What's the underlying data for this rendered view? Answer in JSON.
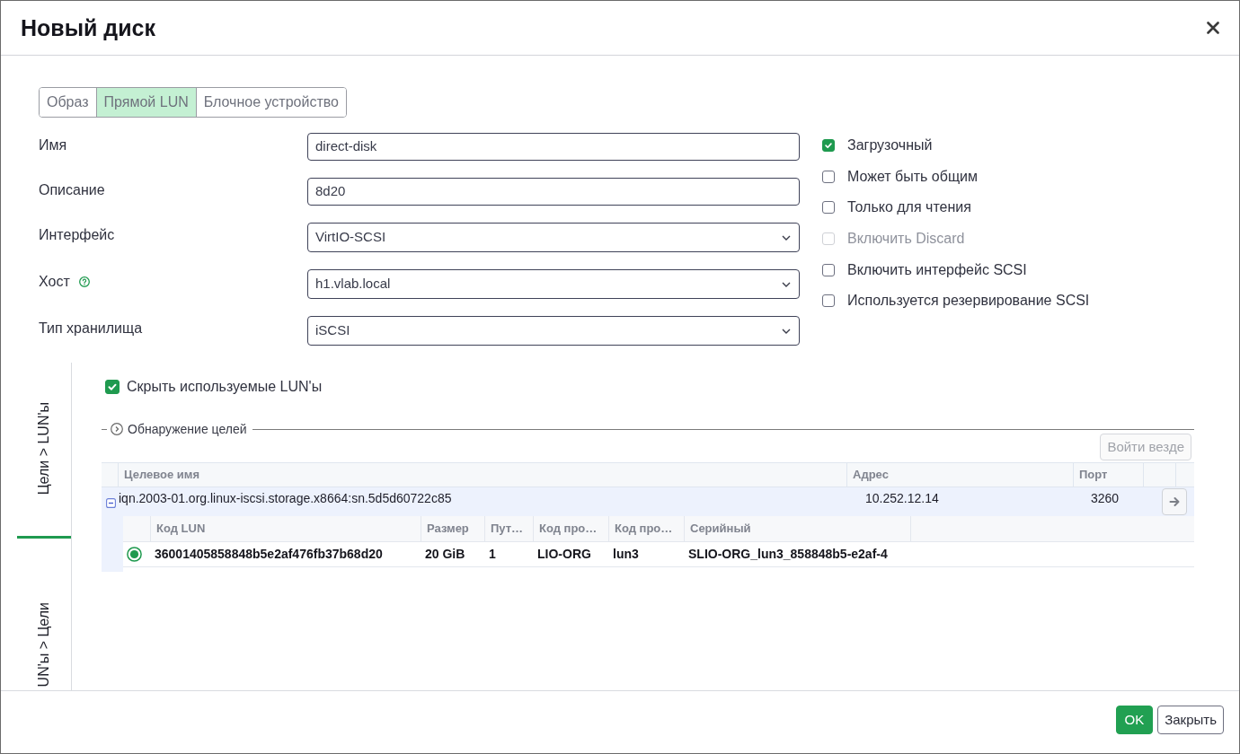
{
  "dialog": {
    "title": "Новый диск"
  },
  "disk_type_tabs": [
    {
      "label": "Образ",
      "selected": false
    },
    {
      "label": "Прямой LUN",
      "selected": true
    },
    {
      "label": "Блочное устройство",
      "selected": false
    }
  ],
  "fields": [
    {
      "label": "Имя",
      "kind": "text",
      "value": "direct-disk",
      "help": false
    },
    {
      "label": "Описание",
      "kind": "text",
      "value": "8d20",
      "help": false
    },
    {
      "label": "Интерфейс",
      "kind": "select",
      "value": "VirtIO-SCSI",
      "help": false
    },
    {
      "label": "Хост",
      "kind": "select",
      "value": "h1.vlab.local",
      "help": true
    },
    {
      "label": "Тип хранилища",
      "kind": "select",
      "value": "iSCSI",
      "help": false
    }
  ],
  "options": [
    {
      "label": "Загрузочный",
      "checked": true,
      "disabled": false
    },
    {
      "label": "Может быть общим",
      "checked": false,
      "disabled": false
    },
    {
      "label": "Только для чтения",
      "checked": false,
      "disabled": false
    },
    {
      "label": "Включить Discard",
      "checked": false,
      "disabled": true
    },
    {
      "label": "Включить интерфейс SCSI",
      "checked": false,
      "disabled": false
    },
    {
      "label": "Используется резервирование SCSI",
      "checked": false,
      "disabled": false
    }
  ],
  "storage_view_tabs": [
    {
      "label": "Цели > LUN'ы",
      "selected": true
    },
    {
      "label": "UN'ы > Цели",
      "selected": false
    }
  ],
  "hide_used_luns": {
    "label": "Скрыть используемые LUN'ы",
    "checked": true
  },
  "discovery": {
    "label": "Обнаружение целей",
    "expanded": false
  },
  "login_all_button": {
    "label": "Войти везде",
    "disabled": true
  },
  "targets": {
    "columns": [
      "Целевое имя",
      "Адрес",
      "Порт"
    ],
    "rows": [
      {
        "cells": [
          "iqn.2003-01.org.linux-iscsi.storage.x8664:sn.5d5d60722c85",
          "10.252.12.14",
          "3260"
        ],
        "expanded": true,
        "luns": {
          "columns": [
            "Код LUN",
            "Размер",
            "Пут…",
            "Код про…",
            "Код про…",
            "Серийный"
          ],
          "rows": [
            {
              "selected": true,
              "cells": [
                "36001405858848b5e2af476fb37b68d20",
                "20 GiB",
                "1",
                "LIO-ORG",
                "lun3",
                "SLIO-ORG_lun3_858848b5-e2af-4"
              ]
            }
          ]
        }
      }
    ]
  },
  "footer_buttons": [
    {
      "label": "OK",
      "kind": "primary"
    },
    {
      "label": "Закрыть",
      "kind": "secondary"
    }
  ]
}
